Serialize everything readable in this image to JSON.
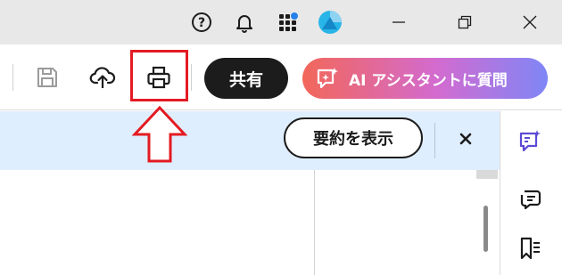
{
  "titlebar": {
    "icons": [
      "help-icon",
      "bell-icon",
      "apps-icon",
      "account-avatar"
    ],
    "window_controls": [
      "minimize-icon",
      "restore-icon",
      "close-icon"
    ]
  },
  "toolbar": {
    "tools": [
      "save-icon",
      "cloud-upload-icon",
      "printer-icon"
    ],
    "share_label": "共有",
    "ai_label": "AI アシスタントに質問"
  },
  "banner": {
    "summary_label": "要約を表示"
  },
  "sidebar": {
    "icons": [
      "ai-sparkle-icon",
      "comment-icon",
      "bookmark-list-icon"
    ]
  },
  "colors": {
    "annotation": "#e31b23",
    "banner_bg": "#dfeefe",
    "accent_purple": "#5b4bd6"
  }
}
